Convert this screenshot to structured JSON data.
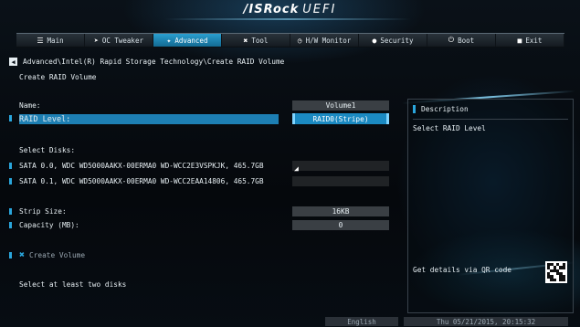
{
  "header": {
    "brand": "/ISRock",
    "product": "UEFI"
  },
  "tabs": [
    {
      "label": "Main",
      "icon": "list-icon"
    },
    {
      "label": "OC Tweaker",
      "icon": "rocket-icon"
    },
    {
      "label": "Advanced",
      "icon": "star-icon",
      "active": true
    },
    {
      "label": "Tool",
      "icon": "tool-icon"
    },
    {
      "label": "H/W Monitor",
      "icon": "monitor-icon"
    },
    {
      "label": "Security",
      "icon": "shield-icon"
    },
    {
      "label": "Boot",
      "icon": "power-icon"
    },
    {
      "label": "Exit",
      "icon": "exit-icon"
    }
  ],
  "breadcrumb": "Advanced\\Intel(R) Rapid Storage Technology\\Create RAID Volume",
  "page_title": "Create RAID Volume",
  "fields": {
    "name_label": "Name:",
    "name_value": "Volume1",
    "raid_level_label": "RAID Level:",
    "raid_level_value": "RAID0(Stripe)",
    "select_disks_label": "Select Disks:",
    "disk1_label": "SATA 0.0, WDC WD5000AAKX-00ERMA0 WD-WCC2E3VSPKJK, 465.7GB",
    "disk2_label": "SATA 0.1, WDC WD5000AAKX-00ERMA0 WD-WCC2EAA14806, 465.7GB",
    "strip_size_label": "Strip Size:",
    "strip_size_value": "16KB",
    "capacity_label": "Capacity (MB):",
    "capacity_value": "0",
    "create_volume_label": "Create Volume"
  },
  "status_text": "Select at least two disks",
  "description": {
    "title": "Description",
    "text": "Select RAID Level",
    "qr_text": "Get details via QR code"
  },
  "footer": {
    "language": "English",
    "datetime": "Thu 05/21/2015, 20:15:32"
  },
  "colors": {
    "accent": "#1d7fb3",
    "highlight": "#2aa6dc"
  }
}
